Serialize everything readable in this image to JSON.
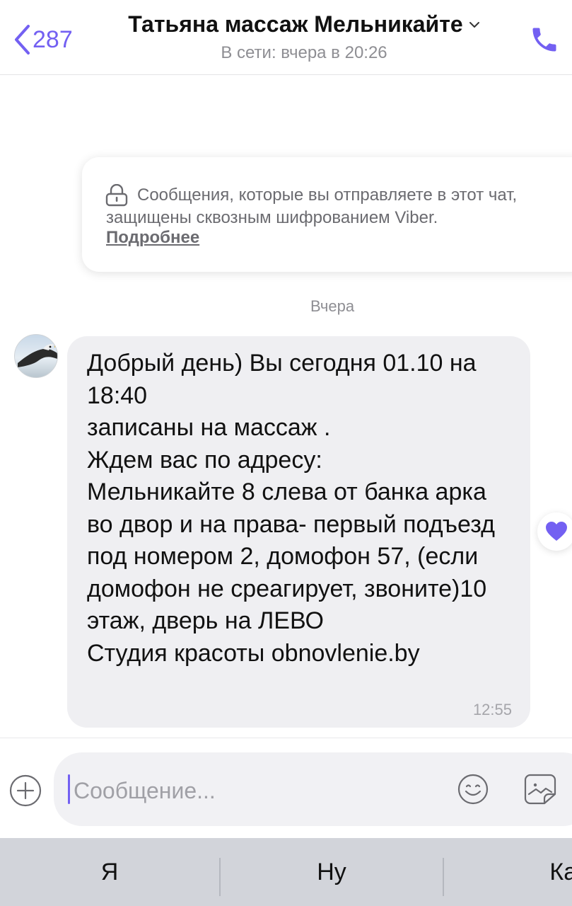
{
  "header": {
    "back_count": "287",
    "contact_name": "Татьяна массаж Мельникайте",
    "status": "В сети: вчера в 20:26",
    "icons": [
      "chevron-left-icon",
      "chevron-down-icon",
      "phone-icon"
    ]
  },
  "encryption_notice": {
    "text": "Сообщения, которые вы отправляете в этот чат, защищены сквозным шифрованием Viber.",
    "link": "Подробнее",
    "icon": "lock-icon"
  },
  "date_separator": "Вчера",
  "message": {
    "text": "Добрый день) Вы сегодня 01.10 на 18:40\nзаписаны на массаж  .\nЖдем вас по адресу:\nМельникайте 8 слева от банка арка во двор и на права- первый подъезд под номером 2, домофон 57, (если домофон не среагирует, звоните)10 этаж, дверь на ЛЕВО\nСтудия красоты obnovlenie.by",
    "time": "12:55",
    "reaction_icon": "heart-icon"
  },
  "composer": {
    "placeholder": "Сообщение...",
    "icons": [
      "plus-icon",
      "emoji-icon",
      "sticker-icon"
    ]
  },
  "keyboard_suggestions": [
    "Я",
    "Ну",
    "Как"
  ],
  "colors": {
    "accent": "#7360f2",
    "bubble": "#efeff2",
    "keyboard": "#d2d4da"
  }
}
